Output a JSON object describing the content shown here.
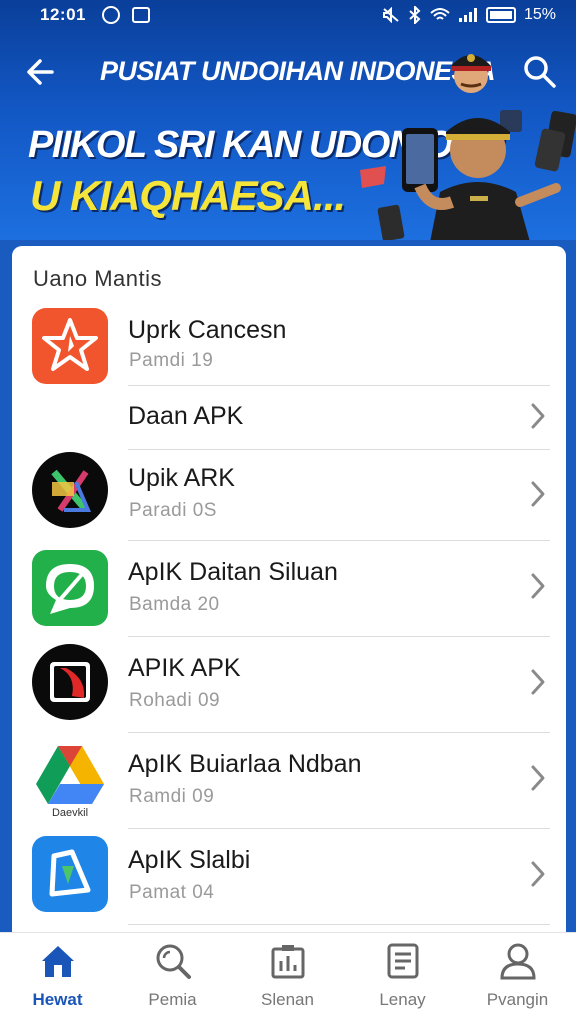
{
  "status_bar": {
    "time": "12:01",
    "battery": "15%"
  },
  "app_bar": {
    "title": "PUSIAT UNDOIHAN INDONESIA"
  },
  "banner": {
    "line1": "PIIKOL SRI KAN UDONIONN",
    "line2": "U KIAQHAESA..."
  },
  "section": {
    "title": "Uano Mantis"
  },
  "list": {
    "items": [
      {
        "name": "Uprk Cancesn",
        "sub": "Pamdi 19",
        "icon": "star-icon"
      },
      {
        "name": "Daan APK",
        "sub": "",
        "icon": ""
      },
      {
        "name": "Upik ARK",
        "sub": "Paradi 0S",
        "icon": "x-logo-icon"
      },
      {
        "name": "ApIK Daitan Siluan",
        "sub": "Bamda 20",
        "icon": "chat-leaf-icon"
      },
      {
        "name": "APIK APK",
        "sub": "Rohadi 09",
        "icon": "slash-box-icon"
      },
      {
        "name": "ApIK Buiarlaa Ndban",
        "sub": "Ramdi 09",
        "icon": "drive-triangle-icon",
        "icon_caption": "Daevkil"
      },
      {
        "name": "ApIK Slalbi",
        "sub": "Pamat 04",
        "icon": "store-a-icon"
      }
    ]
  },
  "bottom_nav": {
    "items": [
      {
        "label": "Hewat",
        "icon": "home-icon",
        "active": true
      },
      {
        "label": "Pemia",
        "icon": "search-zoom-icon",
        "active": false
      },
      {
        "label": "Slenan",
        "icon": "chart-box-icon",
        "active": false
      },
      {
        "label": "Lenay",
        "icon": "document-icon",
        "active": false
      },
      {
        "label": "Pvangin",
        "icon": "user-icon",
        "active": false
      }
    ]
  },
  "colors": {
    "header_blue": "#0a3f9a",
    "accent_blue": "#1a56b8",
    "banner_yellow": "#f5e43a"
  }
}
